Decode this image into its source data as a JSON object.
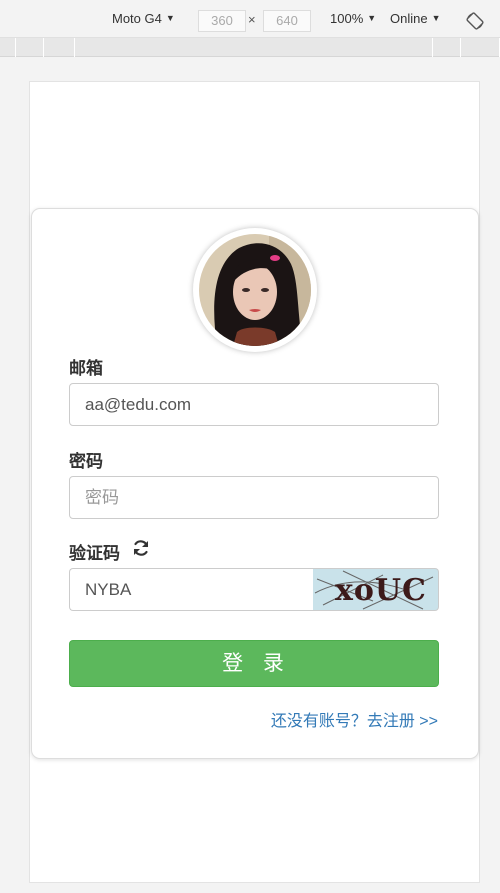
{
  "devtools": {
    "device": "Moto G4",
    "width": "360",
    "height": "640",
    "zoom": "100%",
    "network": "Online",
    "icons": [
      "caret-down-icon",
      "rotate-icon"
    ]
  },
  "login": {
    "email_label": "邮箱",
    "email_value": "aa@tedu.com",
    "password_label": "密码",
    "password_placeholder": "密码",
    "captcha_label": "验证码",
    "captcha_value": "NYBA",
    "captcha_image_text": "xoUC",
    "submit_label": "登 录",
    "register_link": "还没有账号？去注册 >>"
  },
  "colors": {
    "submit_bg": "#5cb85c",
    "link": "#337ab7",
    "captcha_bg": "#c9e2ea"
  }
}
